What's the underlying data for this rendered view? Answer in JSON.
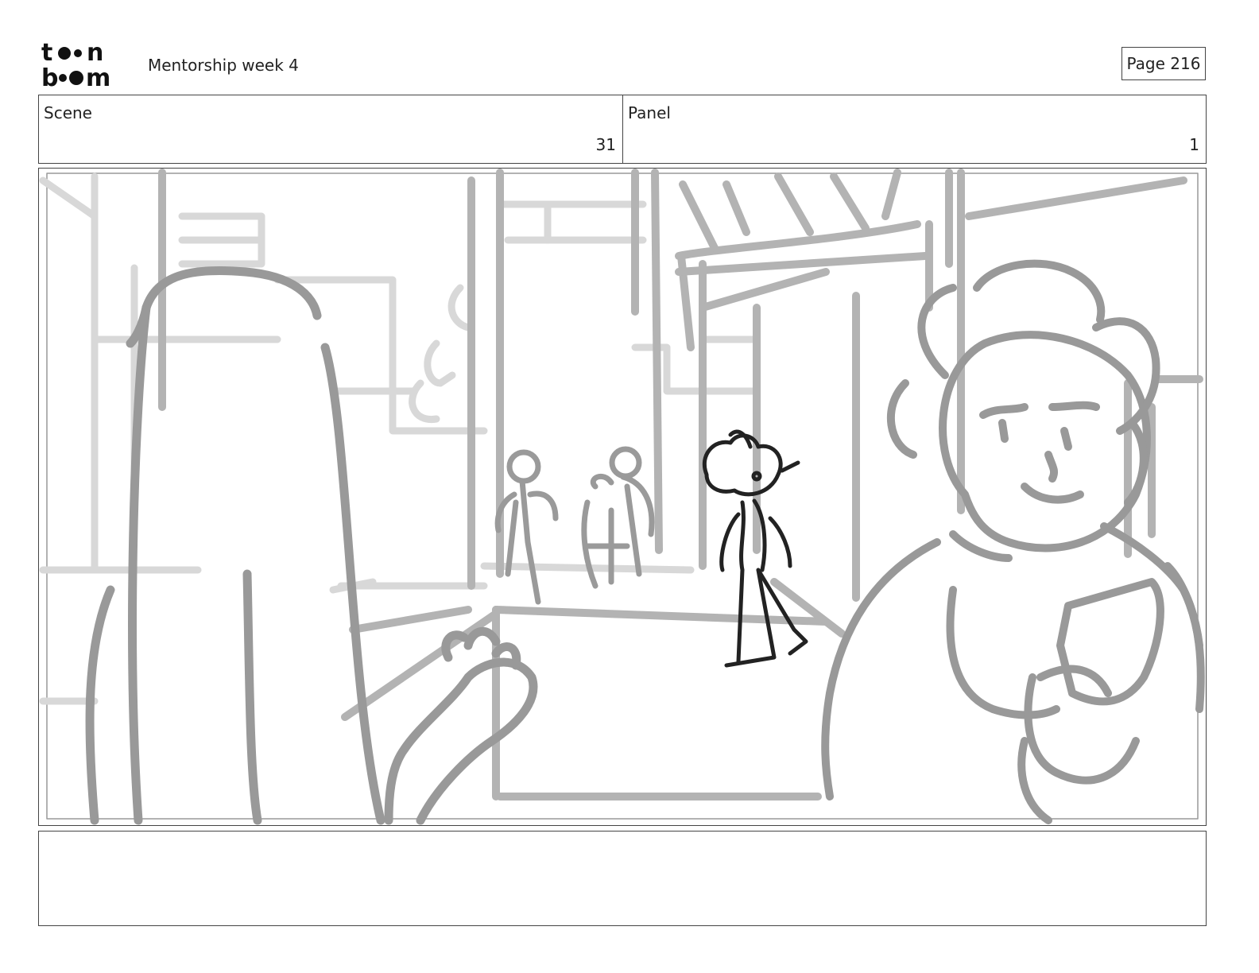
{
  "header": {
    "logo_text_top": "toon",
    "logo_text_bottom": "boom",
    "title": "Mentorship week 4",
    "page_label": "Page 216"
  },
  "info": {
    "scene_label": "Scene",
    "scene_value": "31",
    "panel_label": "Panel",
    "panel_value": "1"
  },
  "notes": {
    "text": ""
  }
}
